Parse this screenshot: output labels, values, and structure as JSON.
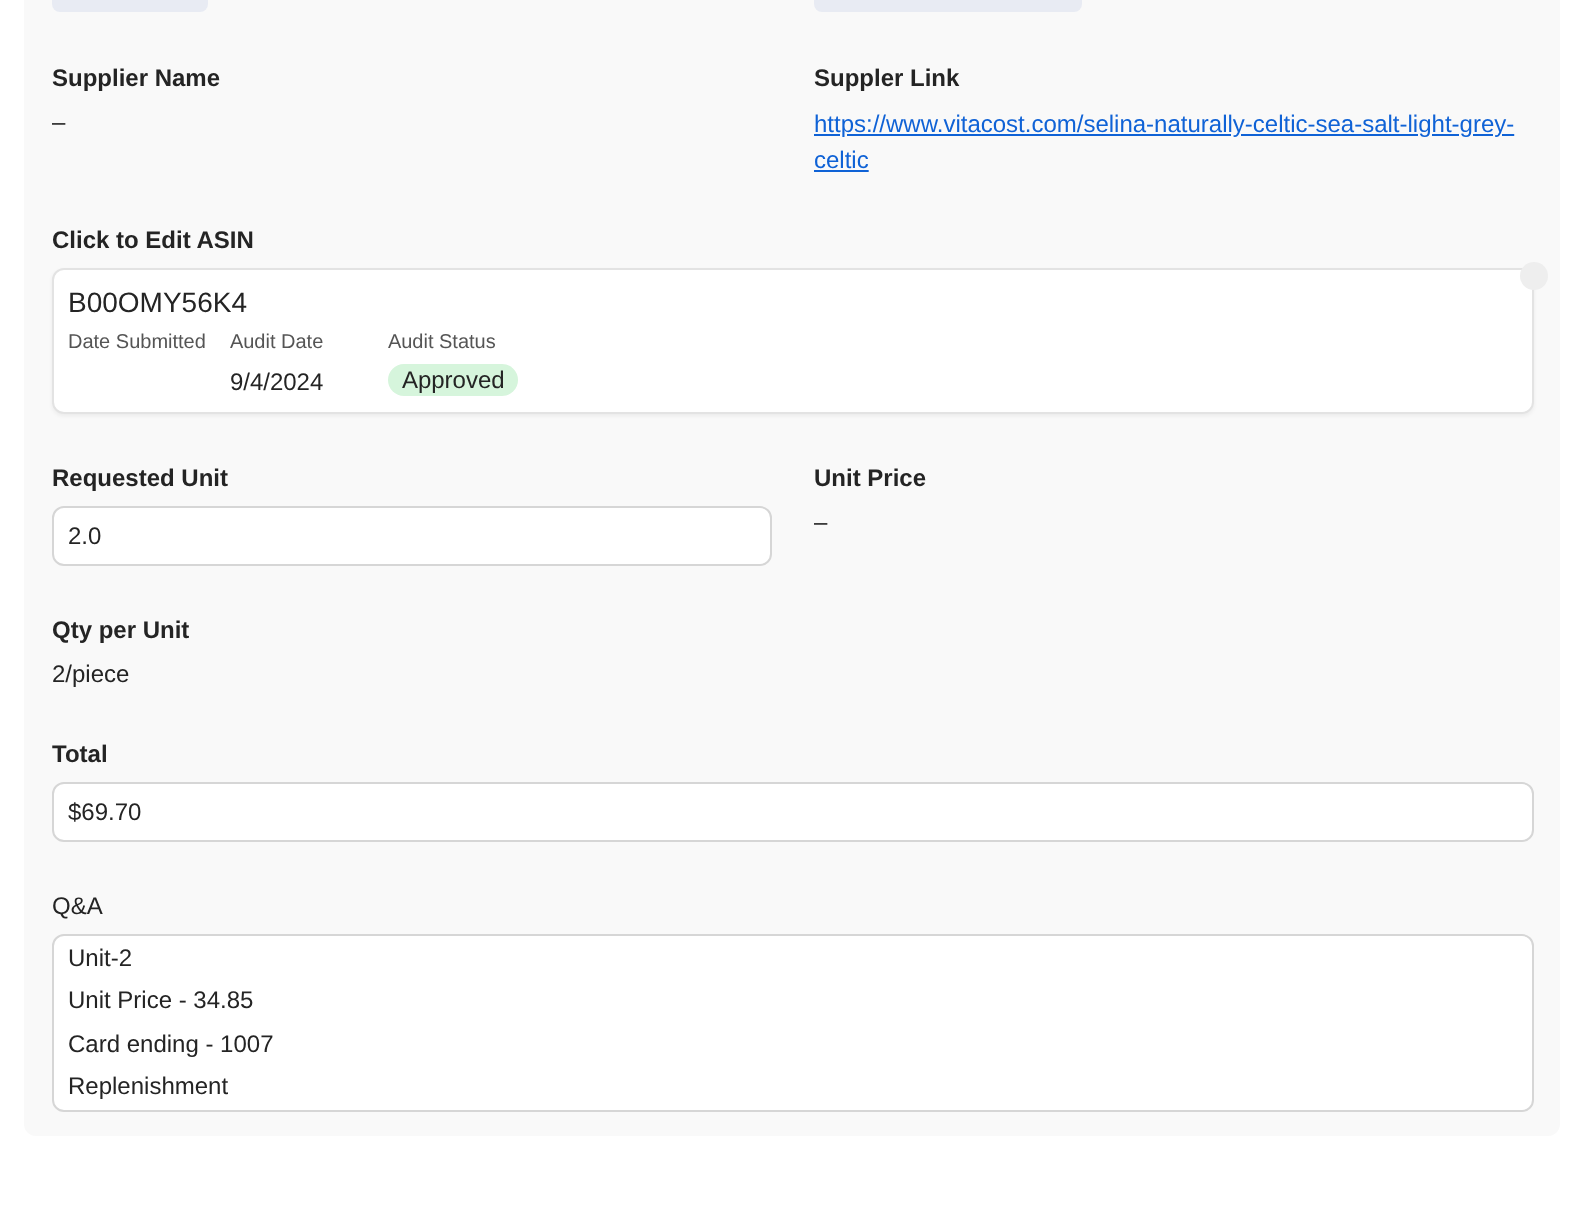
{
  "top_chips": [
    {
      "kind": "chip"
    },
    {
      "kind": "chip"
    }
  ],
  "supplier": {
    "name_label": "Supplier Name",
    "name_value": "–",
    "link_label": "Suppler Link",
    "link": "https://www.vitacost.com/selina-naturally-celtic-sea-salt-light-grey-celtic"
  },
  "asin": {
    "label": "Click to Edit ASIN",
    "value": "B00OMY56K4",
    "columns": [
      {
        "label": "Date Submitted"
      },
      {
        "label": "Audit Date",
        "value": "9/4/2024"
      },
      {
        "label": "Audit Status",
        "value": "Approved",
        "kind": "badge"
      }
    ]
  },
  "requested_unit": {
    "label": "Requested Unit",
    "value": "2.0"
  },
  "unit_price": {
    "label": "Unit Price",
    "value": "–"
  },
  "qty_per_unit": {
    "label": "Qty per Unit",
    "value": "2/piece"
  },
  "total": {
    "label": "Total",
    "value": "$69.70"
  },
  "qa": {
    "label": "Q&A",
    "lines": [
      "Unit-2",
      "Unit Price - 34.85",
      "Card ending - 1007",
      "Replenishment"
    ]
  }
}
